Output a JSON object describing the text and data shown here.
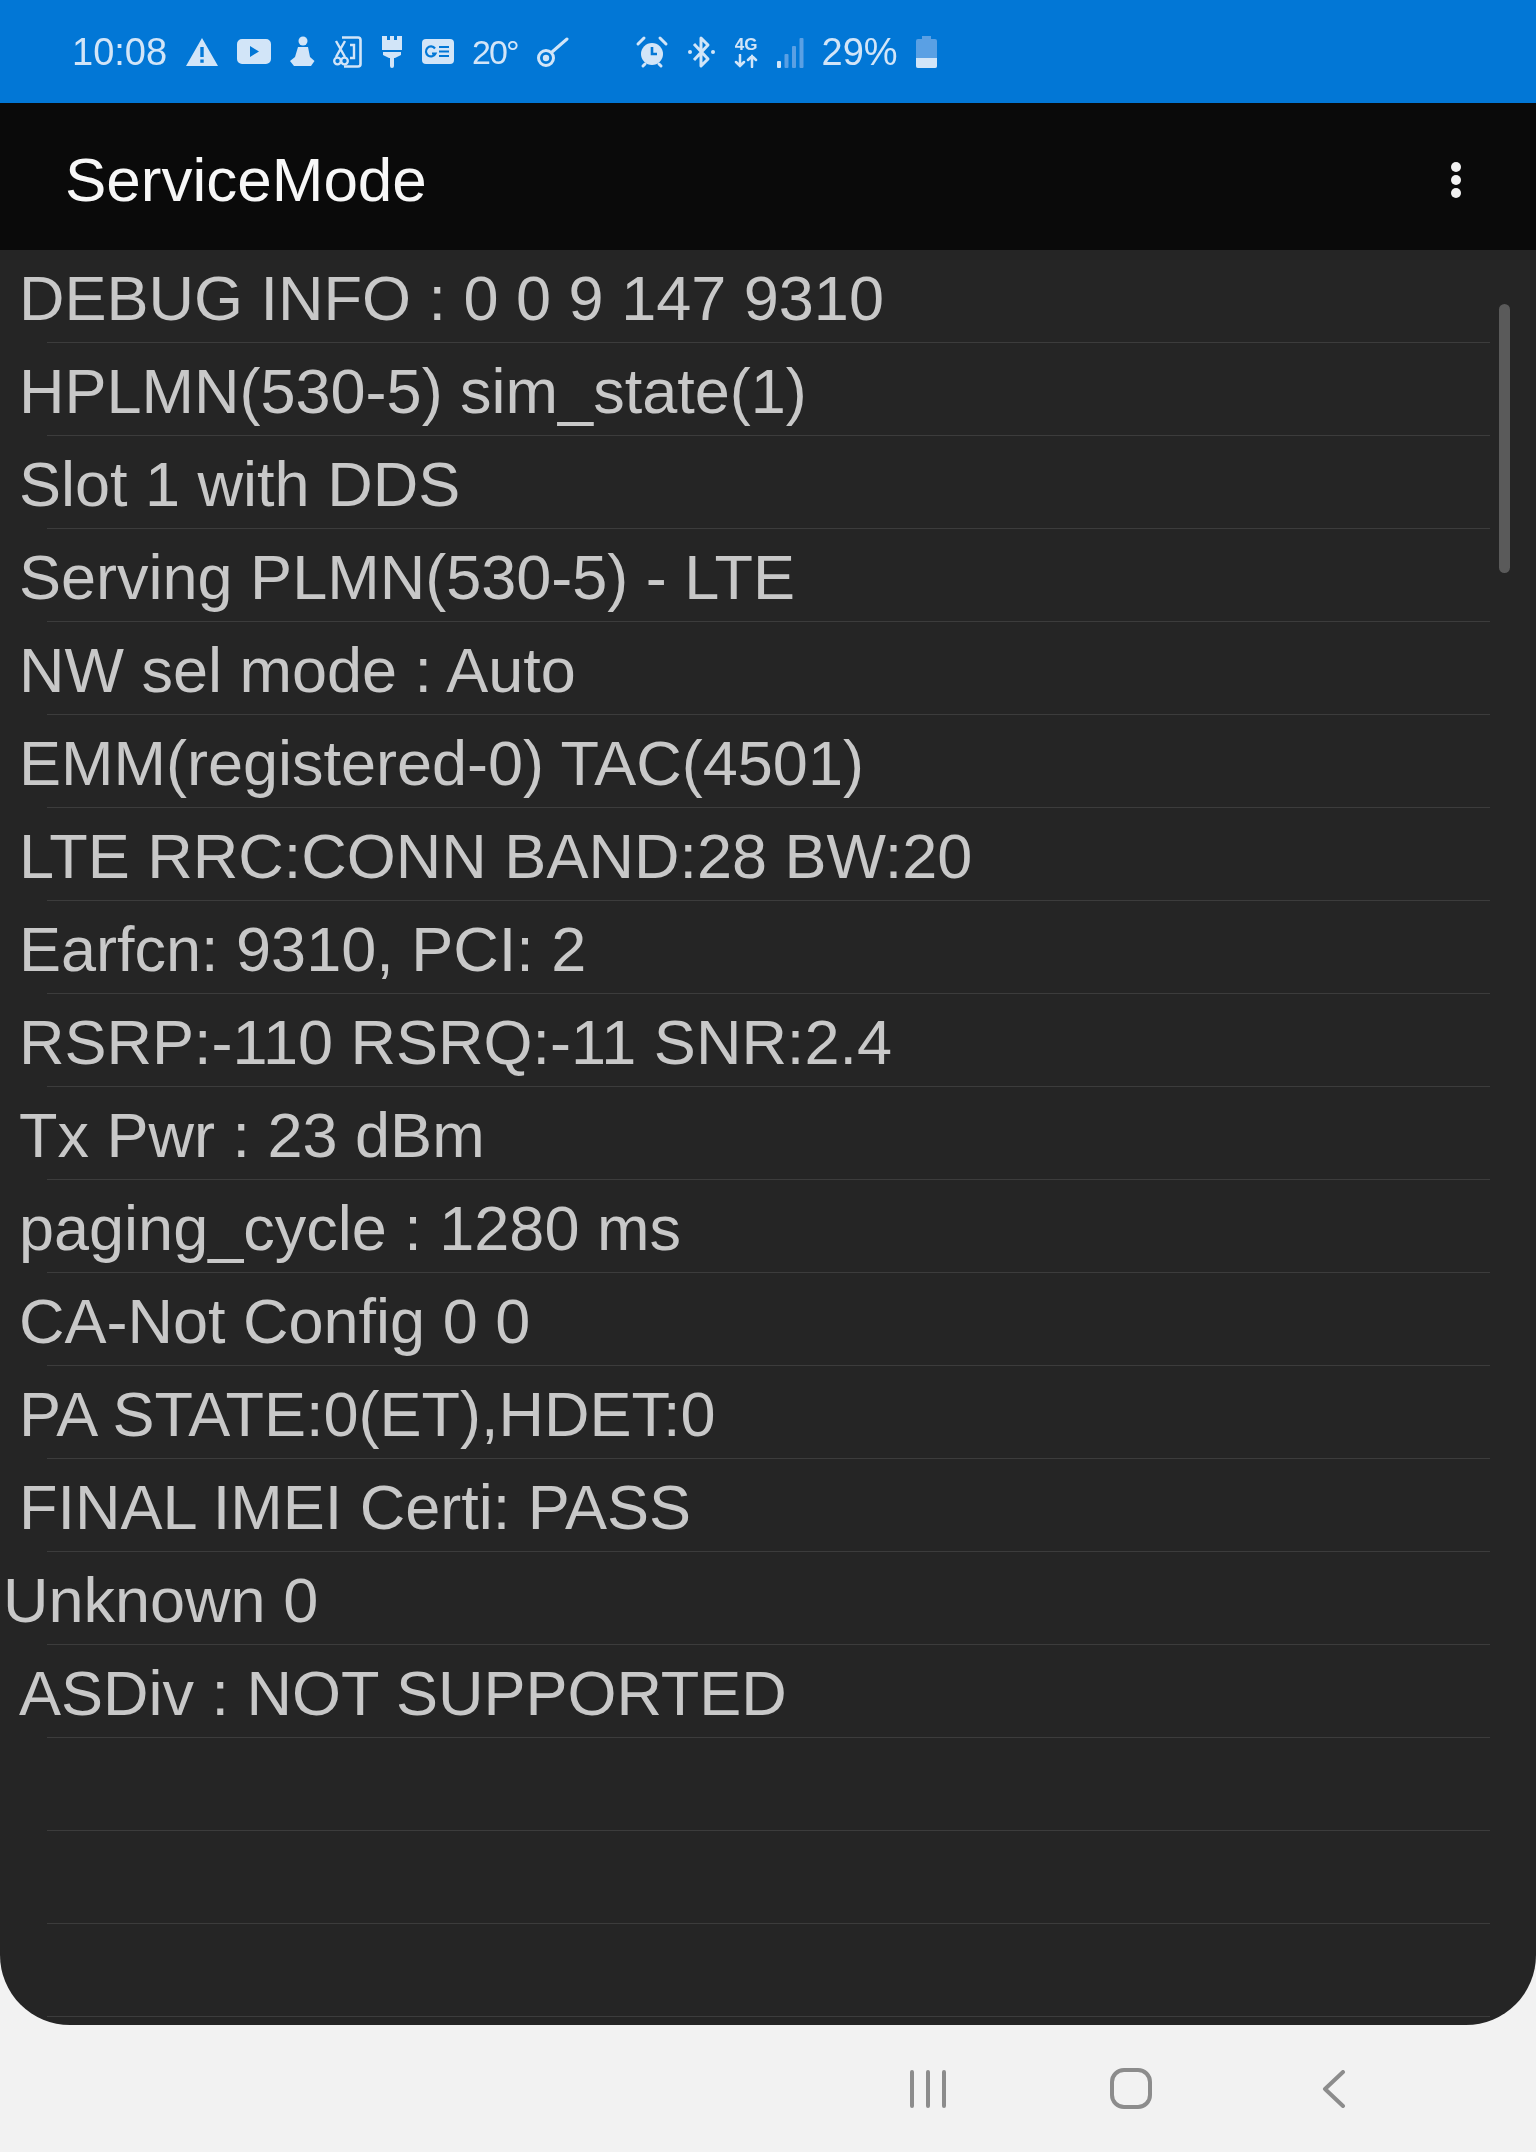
{
  "status_bar": {
    "time": "10:08",
    "temperature": "20°",
    "network_type": "4G",
    "battery": "29%"
  },
  "app_bar": {
    "title": "ServiceMode"
  },
  "rows": [
    {
      "text": "DEBUG INFO : 0 0 9 147 9310",
      "indented": true
    },
    {
      "text": "HPLMN(530-5) sim_state(1)",
      "indented": true
    },
    {
      "text": "Slot 1 with DDS",
      "indented": true
    },
    {
      "text": "Serving PLMN(530-5) - LTE",
      "indented": true
    },
    {
      "text": "NW sel mode : Auto",
      "indented": true
    },
    {
      "text": "EMM(registered-0) TAC(4501)",
      "indented": true
    },
    {
      "text": "LTE RRC:CONN BAND:28 BW:20",
      "indented": true
    },
    {
      "text": "Earfcn: 9310, PCI: 2",
      "indented": true
    },
    {
      "text": "RSRP:-110 RSRQ:-11 SNR:2.4",
      "indented": true
    },
    {
      "text": "Tx Pwr : 23 dBm",
      "indented": true
    },
    {
      "text": "paging_cycle : 1280 ms",
      "indented": true
    },
    {
      "text": "CA-Not Config 0 0",
      "indented": true
    },
    {
      "text": "PA STATE:0(ET),HDET:0",
      "indented": true
    },
    {
      "text": "FINAL IMEI Certi: PASS",
      "indented": true
    },
    {
      "text": "Unknown 0",
      "indented": false
    },
    {
      "text": "ASDiv : NOT SUPPORTED",
      "indented": true
    }
  ]
}
